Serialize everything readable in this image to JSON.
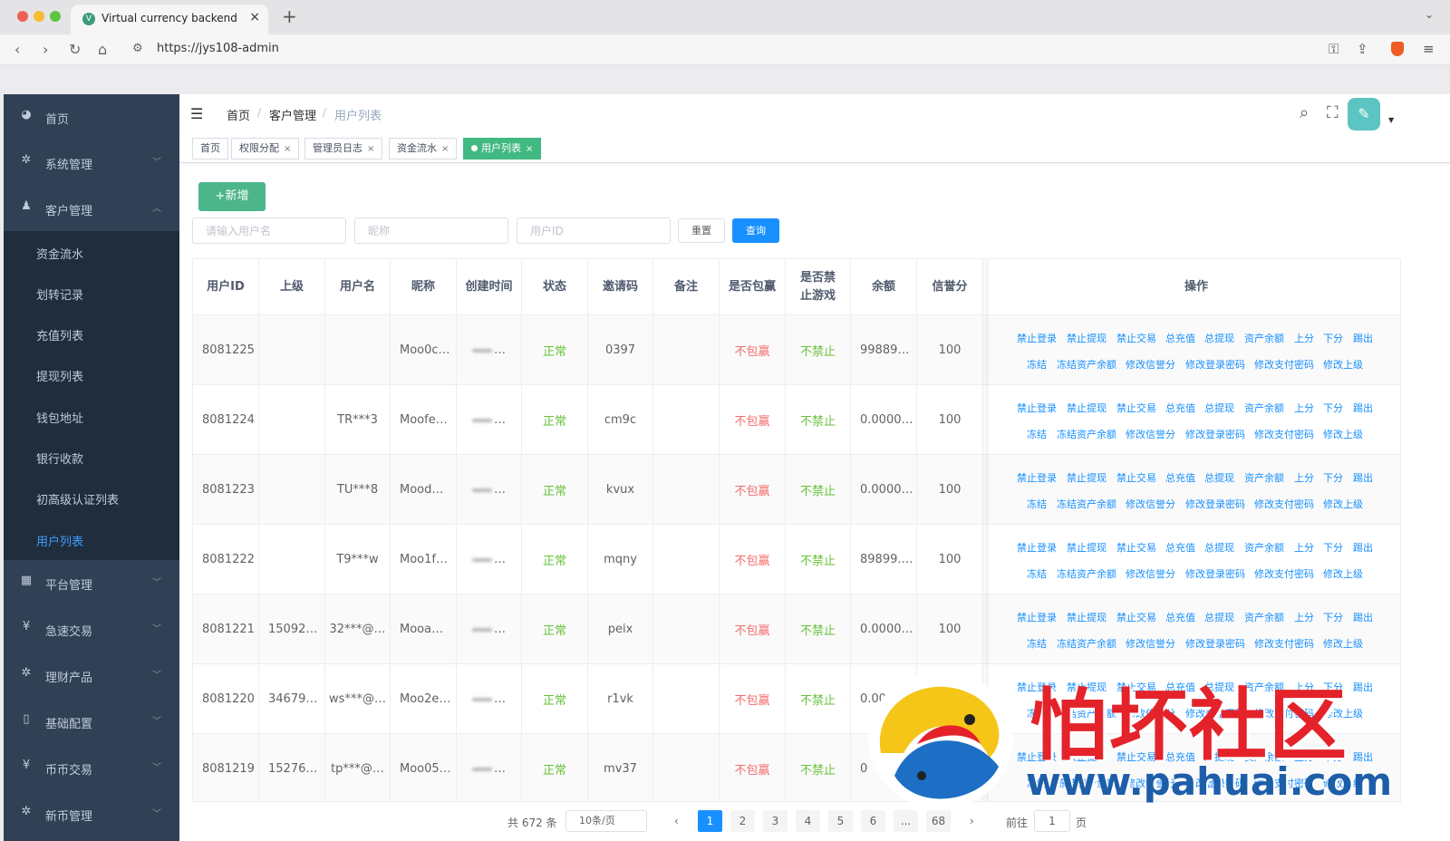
{
  "browser": {
    "tab_title": "Virtual currency backend",
    "url": "https://jys108-admin"
  },
  "sidebar": {
    "items": [
      {
        "label": "首页",
        "icon": "dashboard-icon"
      },
      {
        "label": "系统管理",
        "icon": "gear-icon"
      },
      {
        "label": "客户管理",
        "icon": "user-icon"
      },
      {
        "label": "平台管理",
        "icon": "grid-icon"
      },
      {
        "label": "急速交易",
        "icon": "yen-icon"
      },
      {
        "label": "理财产品",
        "icon": "gear-icon"
      },
      {
        "label": "基础配置",
        "icon": "book-icon"
      },
      {
        "label": "币币交易",
        "icon": "yen-icon"
      },
      {
        "label": "新币管理",
        "icon": "gear-icon"
      }
    ],
    "submenu": [
      "资金流水",
      "划转记录",
      "充值列表",
      "提现列表",
      "钱包地址",
      "银行收款",
      "初高级认证列表",
      "用户列表"
    ]
  },
  "breadcrumb": {
    "home": "首页",
    "section": "客户管理",
    "current": "用户列表"
  },
  "tags": [
    "首页",
    "权限分配",
    "管理员日志",
    "资金流水",
    "用户列表"
  ],
  "filter": {
    "add_label": "+新增",
    "username_placeholder": "请输入用户名",
    "nickname_placeholder": "昵称",
    "userid_placeholder": "用户ID",
    "reset_label": "重置",
    "query_label": "查询"
  },
  "table": {
    "headers": [
      "用户ID",
      "上级",
      "用户名",
      "昵称",
      "创建时间",
      "状态",
      "邀请码",
      "备注",
      "是否包赢",
      "是否禁止游戏",
      "余额",
      "信誉分",
      "操作"
    ],
    "rows": [
      {
        "id": "8081225",
        "parent": "",
        "username": "",
        "nickname": "Moo0c…",
        "created": "…",
        "status": "正常",
        "invite": "0397",
        "remark": "",
        "win": "不包赢",
        "ban": "不禁止",
        "balance": "99889…",
        "credit": "100"
      },
      {
        "id": "8081224",
        "parent": "",
        "username": "TR***3",
        "nickname": "Moofe…",
        "created": "…",
        "status": "正常",
        "invite": "cm9c",
        "remark": "",
        "win": "不包赢",
        "ban": "不禁止",
        "balance": "0.0000…",
        "credit": "100"
      },
      {
        "id": "8081223",
        "parent": "",
        "username": "TU***8",
        "nickname": "Mood…",
        "created": "…",
        "status": "正常",
        "invite": "kvux",
        "remark": "",
        "win": "不包赢",
        "ban": "不禁止",
        "balance": "0.0000…",
        "credit": "100"
      },
      {
        "id": "8081222",
        "parent": "",
        "username": "T9***w",
        "nickname": "Moo1f…",
        "created": "…",
        "status": "正常",
        "invite": "mqny",
        "remark": "",
        "win": "不包赢",
        "ban": "不禁止",
        "balance": "89899.…",
        "credit": "100"
      },
      {
        "id": "8081221",
        "parent": "15092…",
        "username": "32***@…",
        "nickname": "Mooa…",
        "created": "…",
        "status": "正常",
        "invite": "peix",
        "remark": "",
        "win": "不包赢",
        "ban": "不禁止",
        "balance": "0.0000…",
        "credit": "100"
      },
      {
        "id": "8081220",
        "parent": "34679…",
        "username": "ws***@…",
        "nickname": "Moo2e…",
        "created": "…",
        "status": "正常",
        "invite": "r1vk",
        "remark": "",
        "win": "不包赢",
        "ban": "不禁止",
        "balance": "0.00…",
        "credit": ""
      },
      {
        "id": "8081219",
        "parent": "15276…",
        "username": "tp***@…",
        "nickname": "Moo05…",
        "created": "…",
        "status": "正常",
        "invite": "mv37",
        "remark": "",
        "win": "不包赢",
        "ban": "不禁止",
        "balance": "0",
        "credit": ""
      }
    ],
    "actions_line1": [
      "禁止登录",
      "禁止提现",
      "禁止交易",
      "总充值",
      "总提现",
      "资产余额",
      "上分",
      "下分",
      "踢出"
    ],
    "actions_line2": [
      "冻结",
      "冻结资产余额",
      "修改信誉分",
      "修改登录密码",
      "修改支付密码",
      "修改上级"
    ]
  },
  "pagination": {
    "total": "共 672 条",
    "page_size": "10条/页",
    "pages": [
      "1",
      "2",
      "3",
      "4",
      "5",
      "6",
      "...",
      "68"
    ],
    "goto_label": "前往",
    "goto_value": "1",
    "page_unit": "页"
  },
  "watermark": {
    "title": "怕坏社区",
    "url": "www.pahuai.com"
  }
}
